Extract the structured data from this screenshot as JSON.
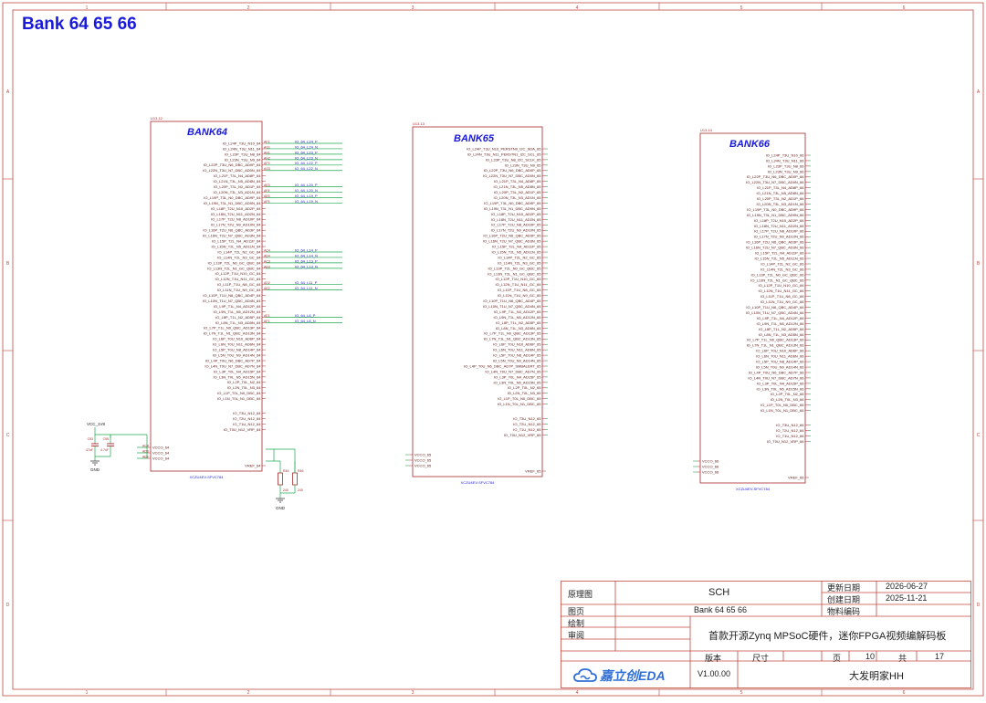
{
  "sheet": {
    "heading": "Bank 64 65 66",
    "border_color": "#c24a3e",
    "wire_color": "#1fa84f",
    "part_color": "#a8282a",
    "label_color": "#1a1adb",
    "col_labels": [
      "1",
      "2",
      "3",
      "4",
      "5",
      "6"
    ],
    "row_labels": [
      "A",
      "B",
      "C",
      "D"
    ]
  },
  "components": [
    {
      "ref": "U13.12",
      "title": "BANK64",
      "part": "XCZU4EV-SFVC784",
      "pins": [
        "IO_L24P_T3U_N10_64",
        "IO_L24N_T3U_N11_64",
        "IO_L23P_T3U_N8_64",
        "IO_L23N_T3U_N9_64",
        "IO_L22P_T3U_N6_DBC_AD0P_64",
        "IO_L22N_T3U_N7_DBC_AD0N_64",
        "IO_L21P_T3L_N4_AD8P_64",
        "IO_L21N_T3L_N5_AD8N_64",
        "IO_L20P_T3L_N2_AD1P_64",
        "IO_L20N_T3L_N3_AD1N_64",
        "IO_L19P_T3L_N0_DBC_AD9P_64",
        "IO_L19N_T3L_N1_DBC_AD9N_64",
        "IO_L18P_T2U_N10_AD2P_64",
        "IO_L18N_T2U_N11_AD2N_64",
        "IO_L17P_T2U_N8_AD10P_64",
        "IO_L17N_T2U_N9_AD10N_64",
        "IO_L16P_T2U_N6_QBC_AD3P_64",
        "IO_L16N_T2U_N7_QBC_AD3N_64",
        "IO_L15P_T2L_N4_AD11P_64",
        "IO_L15N_T2L_N5_AD11N_64",
        "IO_L14P_T2L_N2_GC_64",
        "IO_L14N_T2L_N3_GC_64",
        "IO_L13P_T2L_N0_GC_QBC_64",
        "IO_L13N_T2L_N1_GC_QBC_64",
        "IO_L12P_T1U_N10_GC_64",
        "IO_L12N_T1U_N11_GC_64",
        "IO_L11P_T1U_N8_GC_64",
        "IO_L11N_T1U_N9_GC_64",
        "IO_L10P_T1U_N6_QBC_AD4P_64",
        "IO_L10N_T1U_N7_QBC_AD4N_64",
        "IO_L9P_T1L_N4_AD12P_64",
        "IO_L9N_T1L_N5_AD12N_64",
        "IO_L8P_T1L_N2_AD5P_64",
        "IO_L8N_T1L_N3_AD5N_64",
        "IO_L7P_T1L_N0_QBC_AD13P_64",
        "IO_L7N_T1L_N1_QBC_AD13N_64",
        "IO_L6P_T0U_N10_AD6P_64",
        "IO_L6N_T0U_N11_AD6N_64",
        "IO_L5P_T0U_N8_AD14P_64",
        "IO_L5N_T0U_N9_AD14N_64",
        "IO_L4P_T0U_N6_DBC_AD7P_64",
        "IO_L4N_T0U_N7_DBC_AD7N_64",
        "IO_L3P_T0L_N4_AD15P_64",
        "IO_L3N_T0L_N5_AD15N_64",
        "IO_L2P_T0L_N2_64",
        "IO_L2N_T0L_N3_64",
        "IO_L1P_T0L_N0_DBC_64",
        "IO_L1N_T0L_N1_DBC_64",
        "IO_T3U_N12_64",
        "IO_T2U_N12_64",
        "IO_T1U_N12_64",
        "IO_T0U_N12_VRP_64"
      ],
      "vcco": [
        "VCCO_64",
        "VCCO_64",
        "VCCO_64"
      ],
      "vref": "VREF_64"
    },
    {
      "ref": "U13.13",
      "title": "BANK65",
      "part": "XCZU4EV-SFVC784",
      "pins": [
        "IO_L24P_T3U_N10_PERSTN0_I2C_SDA_65",
        "IO_L24N_T3U_N11_PERSTN1_I2C_SCL_65",
        "IO_L23P_T3U_N8_I2C_SCLK_65",
        "IO_L23N_T3U_N9_65",
        "IO_L22P_T3U_N6_DBC_AD0P_65",
        "IO_L22N_T3U_N7_DBC_AD0N_65",
        "IO_L21P_T3L_N4_AD8P_65",
        "IO_L21N_T3L_N5_AD8N_65",
        "IO_L20P_T3L_N2_AD1P_65",
        "IO_L20N_T3L_N3_AD1N_65",
        "IO_L19P_T3L_N0_DBC_AD9P_65",
        "IO_L19N_T3L_N1_DBC_AD9N_65",
        "IO_L18P_T2U_N10_AD2P_65",
        "IO_L18N_T2U_N11_AD2N_65",
        "IO_L17P_T2U_N8_AD10P_65",
        "IO_L17N_T2U_N9_AD10N_65",
        "IO_L16P_T2U_N6_QBC_AD3P_65",
        "IO_L16N_T2U_N7_QBC_AD3N_65",
        "IO_L15P_T2L_N4_AD11P_65",
        "IO_L15N_T2L_N5_AD11N_65",
        "IO_L14P_T2L_N2_GC_65",
        "IO_L14N_T2L_N3_GC_65",
        "IO_L13P_T2L_N0_GC_QBC_65",
        "IO_L13N_T2L_N1_GC_QBC_65",
        "IO_L12P_T1U_N10_GC_65",
        "IO_L12N_T1U_N11_GC_65",
        "IO_L11P_T1U_N8_GC_65",
        "IO_L11N_T1U_N9_GC_65",
        "IO_L10P_T1U_N6_QBC_AD4P_65",
        "IO_L10N_T1U_N7_QBC_AD4N_65",
        "IO_L9P_T1L_N4_AD12P_65",
        "IO_L9N_T1L_N5_AD12N_65",
        "IO_L8P_T1L_N2_AD5P_65",
        "IO_L8N_T1L_N3_AD5N_65",
        "IO_L7P_T1L_N0_QBC_AD13P_65",
        "IO_L7N_T1L_N1_QBC_AD13N_65",
        "IO_L6P_T0U_N10_AD6P_65",
        "IO_L6N_T0U_N11_AD6N_65",
        "IO_L5P_T0U_N8_AD14P_65",
        "IO_L5N_T0U_N9_AD14N_65",
        "IO_L4P_T0U_N6_DBC_AD7P_SMBALERT_65",
        "IO_L4N_T0U_N7_DBC_AD7N_65",
        "IO_L3P_T0L_N4_AD15P_65",
        "IO_L3N_T0L_N5_AD15N_65",
        "IO_L2P_T0L_N2_65",
        "IO_L2N_T0L_N3_65",
        "IO_L1P_T0L_N0_DBC_65",
        "IO_L1N_T0L_N1_DBC_65",
        "IO_T3U_N12_65",
        "IO_T2U_N12_65",
        "IO_T1U_N12_65",
        "IO_T0U_N12_VRP_65"
      ],
      "vcco": [
        "VCCO_65",
        "VCCO_65",
        "VCCO_65"
      ],
      "vref": "VREF_65"
    },
    {
      "ref": "U13.14",
      "title": "BANK66",
      "part": "XCZU4EV-SFVC784",
      "pins": [
        "IO_L24P_T3U_N10_66",
        "IO_L24N_T3U_N11_66",
        "IO_L23P_T3U_N8_66",
        "IO_L23N_T3U_N9_66",
        "IO_L22P_T3U_N6_DBC_AD0P_66",
        "IO_L22N_T3U_N7_DBC_AD0N_66",
        "IO_L21P_T3L_N4_AD8P_66",
        "IO_L21N_T3L_N5_AD8N_66",
        "IO_L20P_T3L_N2_AD1P_66",
        "IO_L20N_T3L_N3_AD1N_66",
        "IO_L19P_T3L_N0_DBC_AD9P_66",
        "IO_L19N_T3L_N1_DBC_AD9N_66",
        "IO_L18P_T2U_N10_AD2P_66",
        "IO_L18N_T2U_N11_AD2N_66",
        "IO_L17P_T2U_N8_AD10P_66",
        "IO_L17N_T2U_N9_AD10N_66",
        "IO_L16P_T2U_N6_QBC_AD3P_66",
        "IO_L16N_T2U_N7_QBC_AD3N_66",
        "IO_L15P_T2L_N4_AD11P_66",
        "IO_L15N_T2L_N5_AD11N_66",
        "IO_L14P_T2L_N2_GC_66",
        "IO_L14N_T2L_N3_GC_66",
        "IO_L13P_T2L_N0_GC_QBC_66",
        "IO_L13N_T2L_N1_GC_QBC_66",
        "IO_L12P_T1U_N10_GC_66",
        "IO_L12N_T1U_N11_GC_66",
        "IO_L11P_T1U_N8_GC_66",
        "IO_L11N_T1U_N9_GC_66",
        "IO_L10P_T1U_N6_QBC_AD4P_66",
        "IO_L10N_T1U_N7_QBC_AD4N_66",
        "IO_L9P_T1L_N4_AD12P_66",
        "IO_L9N_T1L_N5_AD12N_66",
        "IO_L8P_T1L_N2_AD5P_66",
        "IO_L8N_T1L_N3_AD5N_66",
        "IO_L7P_T1L_N0_QBC_AD13P_66",
        "IO_L7N_T1L_N1_QBC_AD13N_66",
        "IO_L6P_T0U_N10_AD6P_66",
        "IO_L6N_T0U_N11_AD6N_66",
        "IO_L5P_T0U_N8_AD14P_66",
        "IO_L5N_T0U_N9_AD14N_66",
        "IO_L4P_T0U_N6_DBC_AD7P_66",
        "IO_L4N_T0U_N7_DBC_AD7N_66",
        "IO_L3P_T0L_N4_AD15P_66",
        "IO_L3N_T0L_N5_AD15N_66",
        "IO_L2P_T0L_N2_66",
        "IO_L2N_T0L_N3_66",
        "IO_L1P_T0L_N0_DBC_66",
        "IO_L1N_T0L_N1_DBC_66",
        "IO_T3U_N12_66",
        "IO_T2U_N12_66",
        "IO_T1U_N12_66",
        "IO_T0U_N12_VRP_66"
      ],
      "vcco": [
        "VCCO_66",
        "VCCO_66",
        "VCCO_66"
      ],
      "vref": "VREF_66"
    }
  ],
  "bank64_nets": [
    {
      "pin": "AF1",
      "net": "IO_64_L24_P"
    },
    {
      "pin": "AG1",
      "net": "IO_64_L24_N"
    },
    {
      "pin": "AH1",
      "net": "IO_64_L23_P"
    },
    {
      "pin": "AH2",
      "net": "IO_64_L23_N"
    },
    {
      "pin": "AF3",
      "net": "IO_64_L22_P"
    },
    {
      "pin": "AG3",
      "net": "IO_64_L22_N"
    },
    {
      "pin": "AE3",
      "net": "IO_64_L20_P"
    },
    {
      "pin": "AF4",
      "net": "IO_64_L20_N"
    },
    {
      "pin": "AE5",
      "net": "IO_64_L19_P"
    },
    {
      "pin": "AF5",
      "net": "IO_64_L19_N"
    },
    {
      "pin": "AC4",
      "net": "IO_64_L14_P"
    },
    {
      "pin": "AD4",
      "net": "IO_64_L14_N"
    },
    {
      "pin": "AC3",
      "net": "IO_64_L13_P"
    },
    {
      "pin": "AD3",
      "net": "IO_64_L13_N"
    },
    {
      "pin": "AD2",
      "net": "IO_64_L11_P"
    },
    {
      "pin": "AE2",
      "net": "IO_64_L11_N"
    },
    {
      "pin": "AE1",
      "net": "IO_64_L8_P"
    },
    {
      "pin": "AF1",
      "net": "IO_64_L8_N"
    }
  ],
  "bank64_power": {
    "net": "VCC_1V8",
    "caps": [
      {
        "ref": "C53",
        "val": "47uF"
      },
      {
        "ref": "C55",
        "val": "4.7uF"
      }
    ],
    "resistors": [
      {
        "ref": "R45",
        "val": "240"
      },
      {
        "ref": "R46",
        "val": "240"
      }
    ],
    "gnd": "GND",
    "vcco_pins": [
      "AC8",
      "AD8",
      "AE8"
    ]
  },
  "title_block": {
    "type_label": "原理图",
    "type_value": "SCH",
    "updated_label": "更新日期",
    "updated_value": "2026-06-27",
    "created_label": "创建日期",
    "created_value": "2025-11-21",
    "page_label": "图页",
    "page_value": "Bank 64 65 66",
    "part_no_label": "物料编码",
    "drawn_label": "绘制",
    "review_label": "审阅",
    "project": "首款开源Zynq MPSoC硬件，迷你FPGA视频编解码板",
    "version_label": "版本",
    "size_label": "尺寸",
    "page_num_label": "页",
    "page_num": "10",
    "total_label": "共",
    "total": "17",
    "logo_text": "嘉立创EDA",
    "version": "V1.00.00",
    "author": "大发明家HH"
  }
}
